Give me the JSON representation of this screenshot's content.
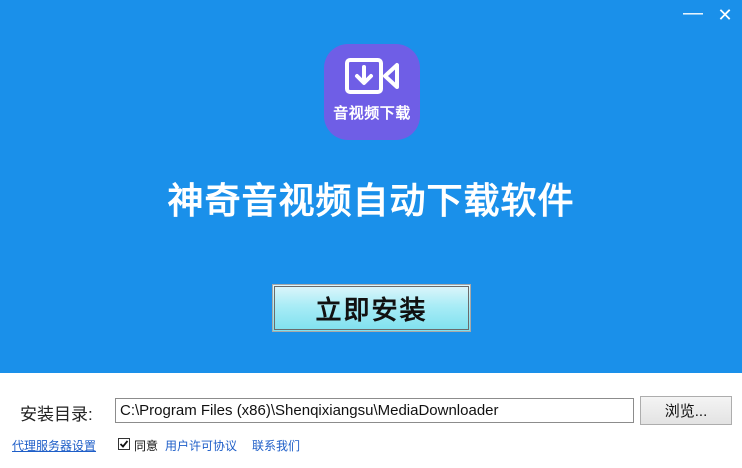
{
  "window": {
    "minimize_glyph": "—",
    "close_glyph": "✕"
  },
  "app": {
    "icon_label": "音视频下载",
    "icon_color": "#6f5ee6",
    "headline": "神奇音视频自动下载软件",
    "hero_color": "#1a90ea"
  },
  "install": {
    "button_label": "立即安装"
  },
  "directory": {
    "label": "安装目录:",
    "value": "C:\\Program Files (x86)\\Shenqixiangsu\\MediaDownloader",
    "browse_label": "浏览..."
  },
  "footer": {
    "proxy_link": "代理服务器设置",
    "agree_checked": true,
    "agree_label": "同意",
    "license_link": "用户许可协议",
    "contact_link": "联系我们"
  }
}
